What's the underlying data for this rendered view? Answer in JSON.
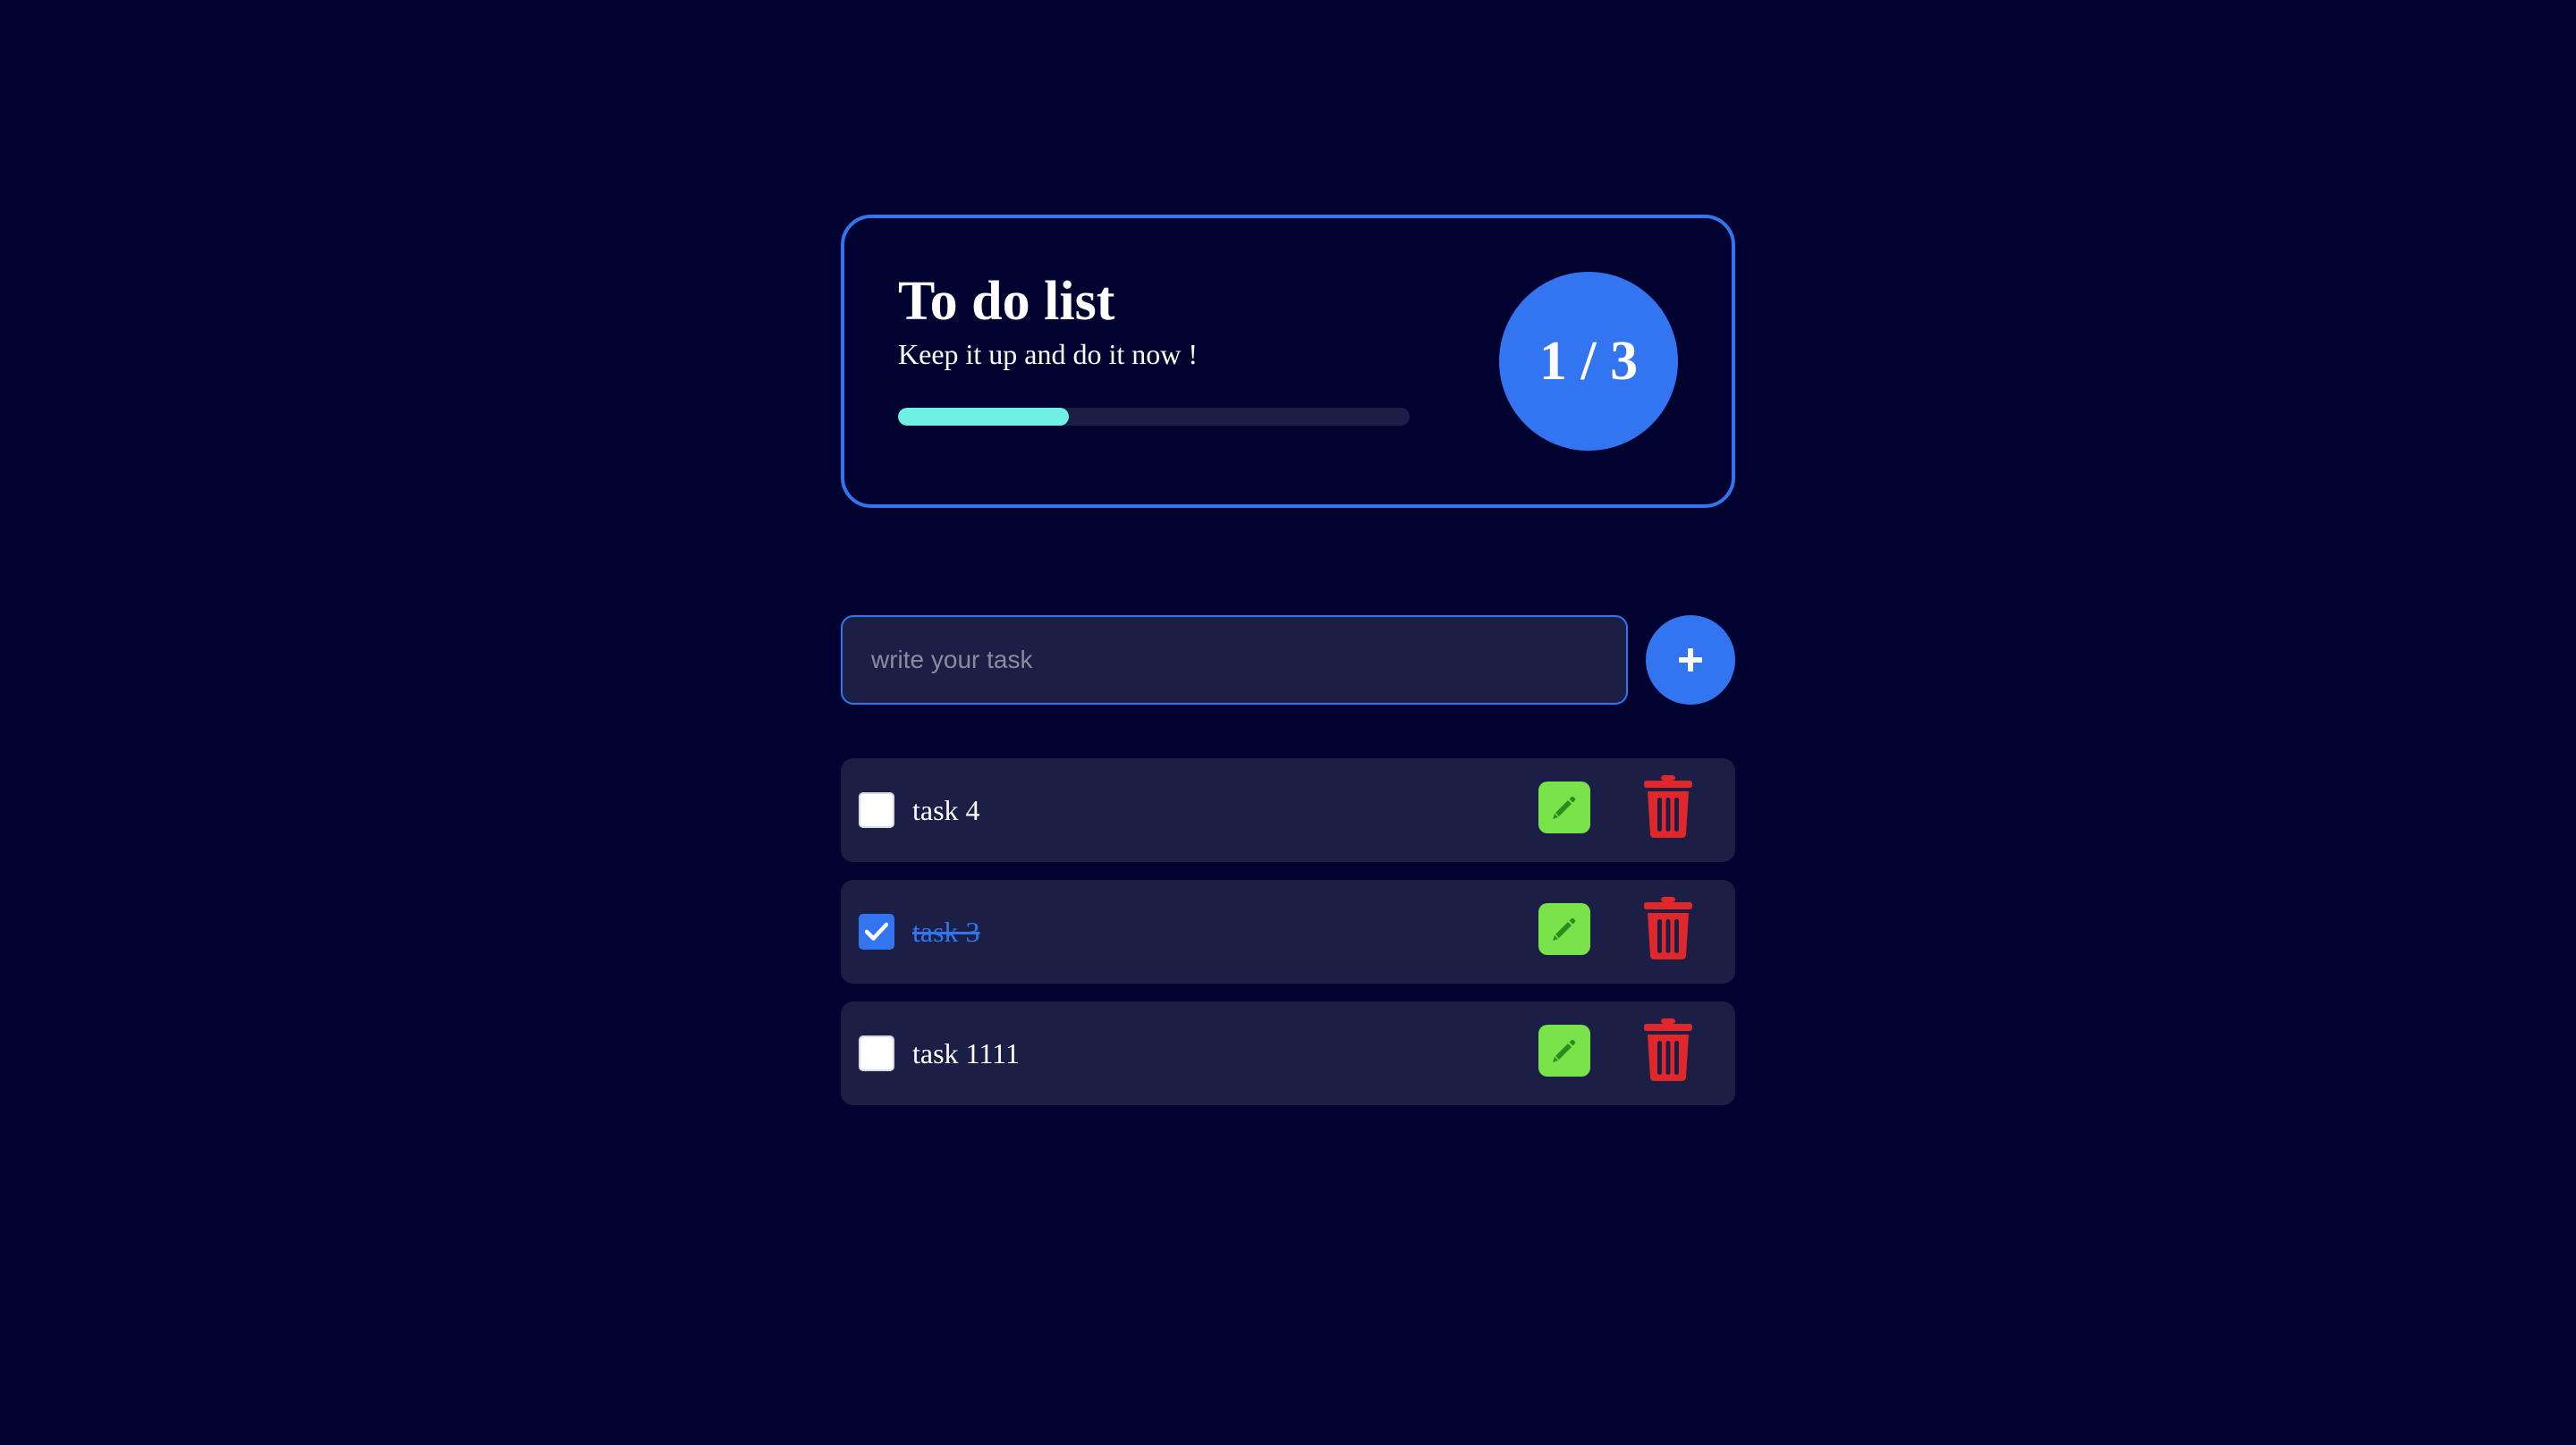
{
  "stats": {
    "title": "To do list",
    "subtitle": "Keep it up and do it now !",
    "counter": "1 / 3",
    "progress": 0.3333
  },
  "add_task": {
    "placeholder": "write your task",
    "button_icon": "plus-icon"
  },
  "tasks": [
    {
      "text": "task 4",
      "completed": false
    },
    {
      "text": "task 3",
      "completed": true
    },
    {
      "text": "task 1111",
      "completed": false
    }
  ],
  "icons": {
    "edit": "pencil-icon",
    "delete": "trash-icon",
    "check": "checkmark-icon"
  },
  "colors": {
    "background": "#000330",
    "accent": "#3375f0",
    "surface": "#1b1e45",
    "progress": "#6ef0e4",
    "edit": "#79e34a",
    "delete": "#e0282a"
  }
}
